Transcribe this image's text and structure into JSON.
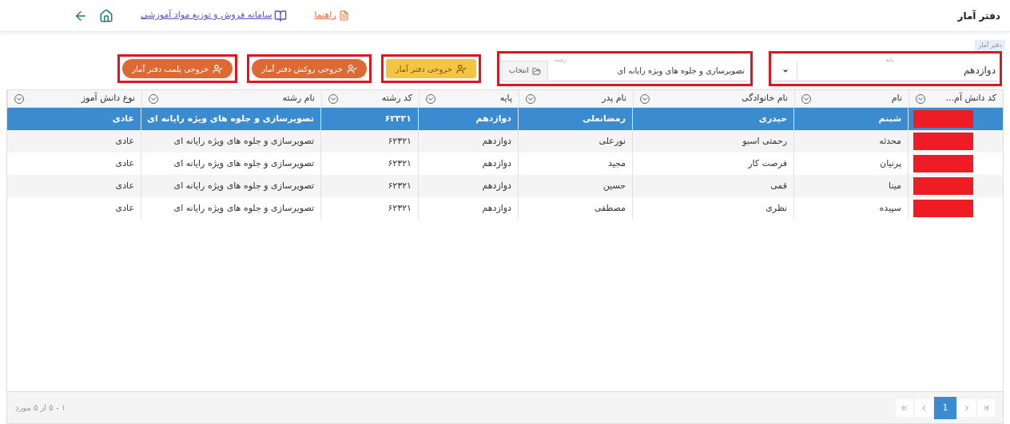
{
  "header": {
    "title": "دفتر آمار",
    "links": [
      {
        "kind": "guide",
        "label": "راهنما"
      },
      {
        "kind": "system",
        "label": "سامانه فروش و توزیع مواد آموزشی"
      }
    ]
  },
  "breadcrumb": "دفتر آمار",
  "filters": [
    {
      "kind": "dropdown",
      "label": "پایه",
      "value": "دوازدهم",
      "highlighted": true
    },
    {
      "kind": "picker",
      "label": "رشته",
      "value": "تصویرسازی و جلوه های ویژه رایانه ای",
      "button": "انتخاب",
      "highlighted": true
    }
  ],
  "buttons": [
    {
      "kind": "yellow",
      "label": "خروجی دفتر آمار",
      "highlighted": true
    },
    {
      "kind": "orange",
      "label": "خروجی روکش دفتر آمار",
      "highlighted": true
    },
    {
      "kind": "orange",
      "label": "خروجی پلمب دفتر آمار",
      "highlighted": true
    }
  ],
  "table": {
    "columns": [
      "کد دانش آم...",
      "نام",
      "نام خانوادگی",
      "نام پدر",
      "پایه",
      "کد رشته",
      "نام رشته",
      "نوع دانش آموز"
    ],
    "rows": [
      {
        "selected": true,
        "redacted": true,
        "cells": [
          "",
          "شبنم",
          "حیدری",
          "رمضانعلی",
          "دوازدهم",
          "۶۲۳۲۱",
          "تصویرسازی و جلوه های ویژه رایانه ای",
          "عادی"
        ]
      },
      {
        "selected": false,
        "redacted": true,
        "cells": [
          "",
          "محدثه",
          "رحمتی اسبو",
          "نورعلی",
          "دوازدهم",
          "۶۲۳۲۱",
          "تصویرسازی و جلوه های ویژه رایانه ای",
          "عادی"
        ]
      },
      {
        "selected": false,
        "redacted": true,
        "cells": [
          "",
          "پرنیان",
          "فرصت کار",
          "مجید",
          "دوازدهم",
          "۶۲۳۲۱",
          "تصویرسازی و جلوه های ویژه رایانه ای",
          "عادی"
        ]
      },
      {
        "selected": false,
        "redacted": true,
        "cells": [
          "",
          "مینا",
          "قمی",
          "حسین",
          "دوازدهم",
          "۶۲۳۲۱",
          "تصویرسازی و جلوه های ویژه رایانه ای",
          "عادی"
        ]
      },
      {
        "selected": false,
        "redacted": true,
        "cells": [
          "",
          "سپیده",
          "نظری",
          "مصطفی",
          "دوازدهم",
          "۶۲۳۲۱",
          "تصویرسازی و جلوه های ویژه رایانه ای",
          "عادی"
        ]
      }
    ]
  },
  "pager": {
    "pages": [
      {
        "label": "1",
        "selected": true
      }
    ],
    "summary": "۱ - ۵ از ۵ مورد"
  }
}
